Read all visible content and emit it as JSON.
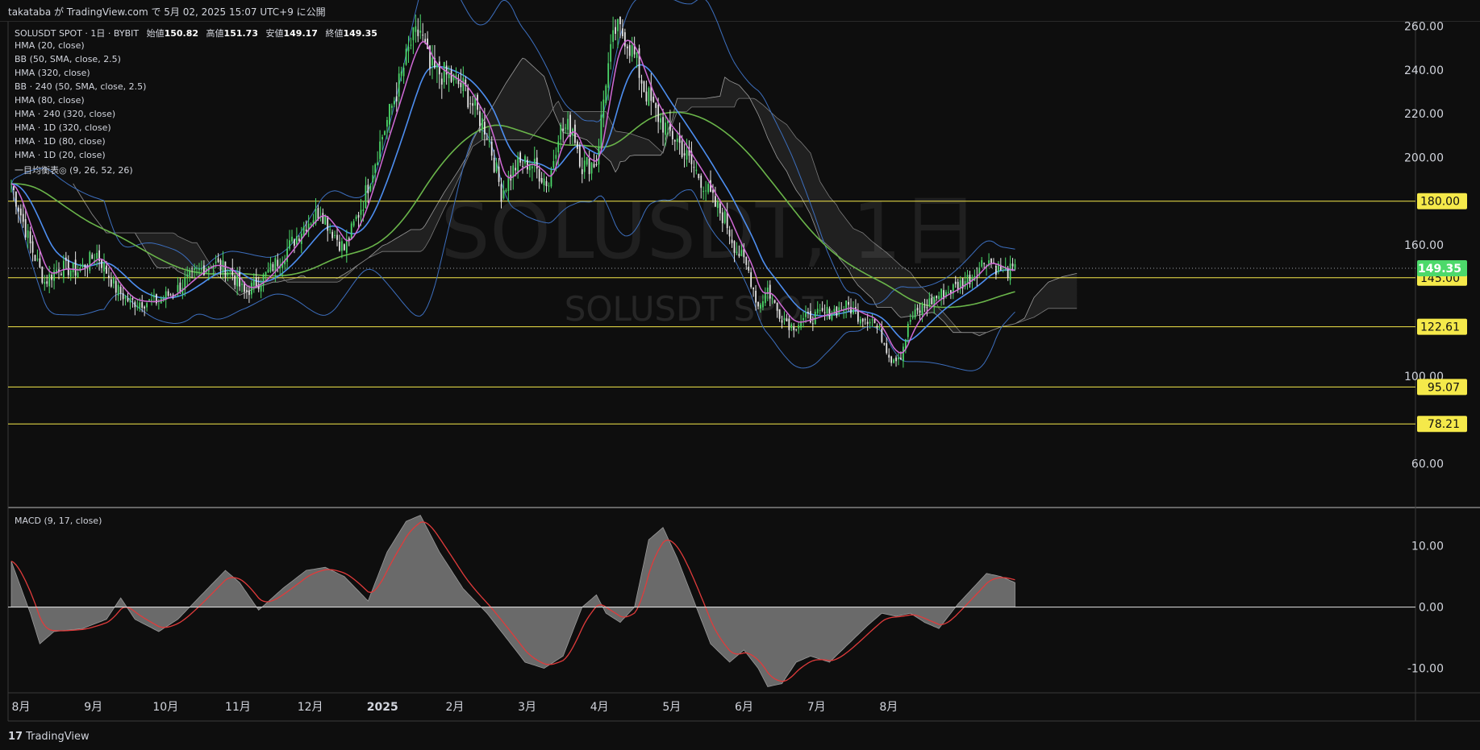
{
  "header": {
    "publish_text": "takataba が TradingView.com で 5月 02, 2025 15:07 UTC+9 に公開"
  },
  "legend": {
    "symbol_line": "SOLUSDT SPOT · 1日 · BYBIT",
    "open_label": "始値",
    "open_value": "150.82",
    "high_label": "高値",
    "high_value": "151.73",
    "low_label": "安値",
    "low_value": "149.17",
    "close_label": "終値",
    "close_value": "149.35",
    "indicators": [
      "HMA (20, close)",
      "BB (50, SMA, close, 2.5)",
      "HMA (320, close)",
      "BB · 240 (50, SMA, close, 2.5)",
      "HMA (80, close)",
      "HMA · 240 (320, close)",
      "HMA · 1D (320, close)",
      "HMA · 1D (80, close)",
      "HMA · 1D (20, close)",
      "一目均衡表◎ (9, 26, 52, 26)"
    ]
  },
  "watermark": {
    "big": "SOLUSDT, 1日",
    "small": "SOLUSDT SPOT"
  },
  "macd": {
    "label": "MACD (9, 17, close)"
  },
  "footer": {
    "brand": "TradingView",
    "mark": "17"
  },
  "colors": {
    "background": "#0e0e0e",
    "up": "#4cd96a",
    "down": "#e6e6e6",
    "hma20": "#d16ad6",
    "hma80": "#4d8ef0",
    "hma320": "#6ab54a",
    "bb": "#3c6ebd",
    "level": "#f5e94a",
    "price_tag": "#4cd96a",
    "macd_fill": "#7a7a7a",
    "signal": "#e03b3b"
  },
  "chart_data": {
    "type": "candlestick",
    "price_axis": {
      "min": 40,
      "max": 262,
      "ticks": [
        "260.00",
        "240.00",
        "220.00",
        "200.00",
        "160.00",
        "100.00",
        "60.00"
      ]
    },
    "time_axis": {
      "labels": [
        "8月",
        "9月",
        "10月",
        "11月",
        "12月",
        "2025",
        "2月",
        "3月",
        "4月",
        "5月",
        "6月",
        "7月",
        "8月"
      ]
    },
    "horizontal_levels": [
      180.0,
      145.0,
      122.61,
      95.07,
      78.21
    ],
    "level_labels": [
      "180.00",
      "145.00",
      "122.61",
      "95.07",
      "78.21"
    ],
    "last_price": 149.35,
    "last_price_label": "149.35",
    "close_anchors": [
      [
        0,
        188
      ],
      [
        8,
        160
      ],
      [
        14,
        143
      ],
      [
        20,
        150
      ],
      [
        28,
        148
      ],
      [
        36,
        156
      ],
      [
        44,
        140
      ],
      [
        50,
        134
      ],
      [
        60,
        134
      ],
      [
        68,
        138
      ],
      [
        76,
        146
      ],
      [
        84,
        152
      ],
      [
        92,
        148
      ],
      [
        98,
        138
      ],
      [
        106,
        145
      ],
      [
        116,
        158
      ],
      [
        124,
        170
      ],
      [
        130,
        176
      ],
      [
        134,
        168
      ],
      [
        140,
        158
      ],
      [
        148,
        180
      ],
      [
        156,
        210
      ],
      [
        162,
        230
      ],
      [
        168,
        252
      ],
      [
        172,
        258
      ],
      [
        176,
        240
      ],
      [
        182,
        238
      ],
      [
        190,
        232
      ],
      [
        196,
        220
      ],
      [
        200,
        212
      ],
      [
        206,
        184
      ],
      [
        212,
        196
      ],
      [
        218,
        198
      ],
      [
        226,
        188
      ],
      [
        230,
        212
      ],
      [
        236,
        214
      ],
      [
        240,
        196
      ],
      [
        246,
        198
      ],
      [
        250,
        236
      ],
      [
        254,
        258
      ],
      [
        258,
        256
      ],
      [
        262,
        246
      ],
      [
        266,
        232
      ],
      [
        270,
        222
      ],
      [
        276,
        212
      ],
      [
        280,
        208
      ],
      [
        284,
        200
      ],
      [
        290,
        190
      ],
      [
        296,
        178
      ],
      [
        300,
        172
      ],
      [
        304,
        160
      ],
      [
        310,
        148
      ],
      [
        314,
        132
      ],
      [
        318,
        140
      ],
      [
        322,
        130
      ],
      [
        328,
        123
      ],
      [
        334,
        126
      ],
      [
        340,
        128
      ],
      [
        346,
        130
      ],
      [
        352,
        132
      ],
      [
        356,
        128
      ],
      [
        362,
        126
      ],
      [
        366,
        118
      ],
      [
        370,
        108
      ],
      [
        374,
        110
      ],
      [
        378,
        126
      ],
      [
        384,
        132
      ],
      [
        390,
        137
      ],
      [
        396,
        140
      ],
      [
        404,
        146
      ],
      [
        410,
        154
      ],
      [
        414,
        150
      ],
      [
        418,
        148
      ],
      [
        422,
        148
      ]
    ],
    "macd_axis": {
      "min": -14,
      "max": 16,
      "ticks": [
        "10.00",
        "0.00",
        "-10.00"
      ]
    },
    "macd_anchors": [
      [
        0,
        7.5
      ],
      [
        8,
        -1
      ],
      [
        12,
        -6
      ],
      [
        18,
        -4
      ],
      [
        30,
        -3.5
      ],
      [
        40,
        -2
      ],
      [
        46,
        1.5
      ],
      [
        52,
        -2
      ],
      [
        62,
        -4
      ],
      [
        70,
        -2
      ],
      [
        80,
        2
      ],
      [
        90,
        6
      ],
      [
        96,
        4
      ],
      [
        104,
        -0.5
      ],
      [
        114,
        3
      ],
      [
        124,
        6
      ],
      [
        132,
        6.5
      ],
      [
        140,
        5
      ],
      [
        150,
        1
      ],
      [
        158,
        9
      ],
      [
        166,
        14
      ],
      [
        172,
        15
      ],
      [
        180,
        9
      ],
      [
        190,
        3
      ],
      [
        200,
        -1
      ],
      [
        208,
        -5
      ],
      [
        216,
        -9
      ],
      [
        224,
        -10
      ],
      [
        232,
        -8
      ],
      [
        240,
        0
      ],
      [
        246,
        2
      ],
      [
        250,
        -1
      ],
      [
        256,
        -2.5
      ],
      [
        262,
        0
      ],
      [
        268,
        11
      ],
      [
        274,
        13
      ],
      [
        280,
        8
      ],
      [
        286,
        2
      ],
      [
        294,
        -6
      ],
      [
        302,
        -9
      ],
      [
        308,
        -7
      ],
      [
        314,
        -10
      ],
      [
        318,
        -13
      ],
      [
        324,
        -12.5
      ],
      [
        330,
        -9
      ],
      [
        336,
        -8
      ],
      [
        344,
        -9
      ],
      [
        352,
        -6
      ],
      [
        360,
        -3
      ],
      [
        366,
        -1
      ],
      [
        372,
        -1.5
      ],
      [
        378,
        -1
      ],
      [
        384,
        -2.5
      ],
      [
        390,
        -3.5
      ],
      [
        398,
        0.5
      ],
      [
        404,
        3
      ],
      [
        410,
        5.5
      ],
      [
        416,
        5
      ],
      [
        422,
        4
      ]
    ],
    "n_bars": 423
  }
}
